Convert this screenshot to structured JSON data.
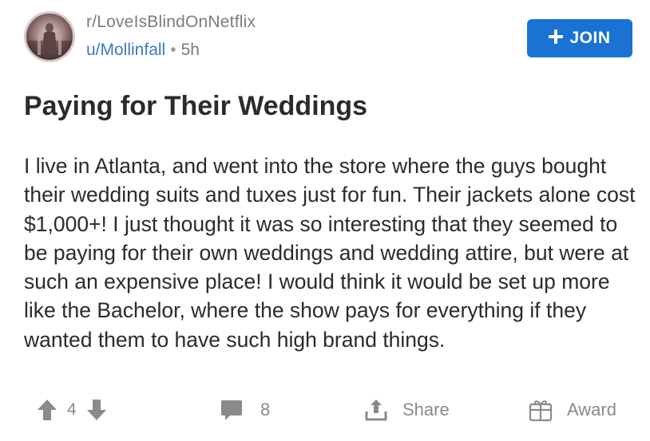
{
  "post": {
    "subreddit": "r/LoveIsBlindOnNetflix",
    "author": "u/Mollinfall",
    "separator": "•",
    "age": "5h",
    "join_label": "JOIN",
    "join_icon": "plus-icon",
    "title": "Paying for Their Weddings",
    "body": "I live in Atlanta, and went into the store where the guys bought their wedding suits and tuxes just for fun. Their jackets alone cost $1,000+! I just thought it was so interesting that they seemed to be paying for their own weddings and wedding attire, but were at such an expensive place! I would think it would be set up more like the Bachelor, where the show pays for everything if they wanted them to have such high brand things."
  },
  "actions": {
    "vote_count": "4",
    "comment_count": "8",
    "share_label": "Share",
    "award_label": "Award"
  },
  "colors": {
    "accent": "#1a73d4",
    "username": "#3a78c8",
    "muted": "#8a8a8a"
  }
}
